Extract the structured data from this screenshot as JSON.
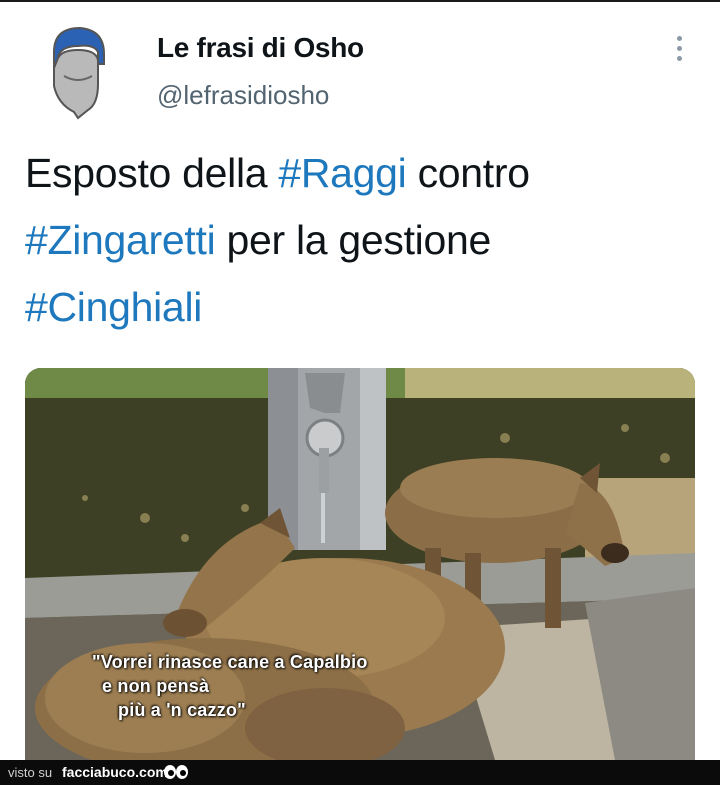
{
  "author": {
    "display_name": "Le frasi di Osho",
    "handle": "@lefrasidiosho",
    "avatar_icon": "bearded-man-avatar-icon"
  },
  "tweet": {
    "line1_text": "Esposto della ",
    "line1_tag": "#Raggi",
    "line1_rest": " contro",
    "line2_tag": "#Zingaretti",
    "line2_rest": " per la gestione",
    "line3_tag": "#Cinghiali"
  },
  "media": {
    "caption_line1": "\"Vorrei rinasce cane a Capalbio",
    "caption_line2": "e non pensà",
    "caption_line3": "più a 'n cazzo\""
  },
  "footer": {
    "visto_su": "visto su",
    "brand": "facciabuco.com",
    "eyes_icon": "eyes-icon"
  },
  "colors": {
    "hashtag": "#1d78bd",
    "text": "#0f1419",
    "handle": "#536471"
  }
}
